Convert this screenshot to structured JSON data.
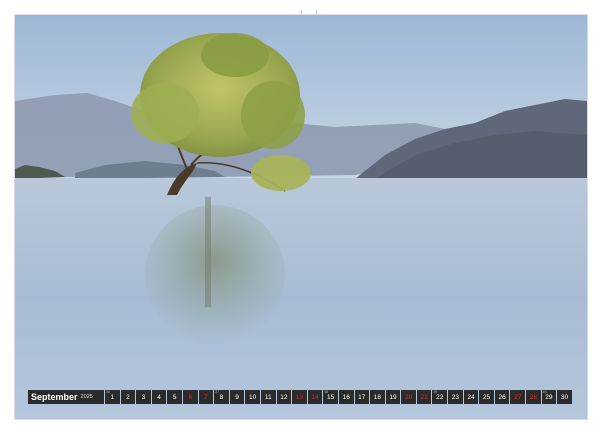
{
  "calendar": {
    "month": "September",
    "year": "2025",
    "days": [
      {
        "num": "1",
        "weekend": false,
        "week": "36"
      },
      {
        "num": "2",
        "weekend": false,
        "week": ""
      },
      {
        "num": "3",
        "weekend": false,
        "week": ""
      },
      {
        "num": "4",
        "weekend": false,
        "week": ""
      },
      {
        "num": "5",
        "weekend": false,
        "week": ""
      },
      {
        "num": "6",
        "weekend": true,
        "week": ""
      },
      {
        "num": "7",
        "weekend": true,
        "week": ""
      },
      {
        "num": "8",
        "weekend": false,
        "week": "37"
      },
      {
        "num": "9",
        "weekend": false,
        "week": ""
      },
      {
        "num": "10",
        "weekend": false,
        "week": ""
      },
      {
        "num": "11",
        "weekend": false,
        "week": ""
      },
      {
        "num": "12",
        "weekend": false,
        "week": ""
      },
      {
        "num": "13",
        "weekend": true,
        "week": ""
      },
      {
        "num": "14",
        "weekend": true,
        "week": ""
      },
      {
        "num": "15",
        "weekend": false,
        "week": "38"
      },
      {
        "num": "16",
        "weekend": false,
        "week": ""
      },
      {
        "num": "17",
        "weekend": false,
        "week": ""
      },
      {
        "num": "18",
        "weekend": false,
        "week": ""
      },
      {
        "num": "19",
        "weekend": false,
        "week": ""
      },
      {
        "num": "20",
        "weekend": true,
        "week": ""
      },
      {
        "num": "21",
        "weekend": true,
        "week": ""
      },
      {
        "num": "22",
        "weekend": false,
        "week": "39"
      },
      {
        "num": "23",
        "weekend": false,
        "week": ""
      },
      {
        "num": "24",
        "weekend": false,
        "week": ""
      },
      {
        "num": "25",
        "weekend": false,
        "week": ""
      },
      {
        "num": "26",
        "weekend": false,
        "week": ""
      },
      {
        "num": "27",
        "weekend": true,
        "week": ""
      },
      {
        "num": "28",
        "weekend": true,
        "week": ""
      },
      {
        "num": "29",
        "weekend": false,
        "week": "40"
      },
      {
        "num": "30",
        "weekend": false,
        "week": ""
      }
    ]
  },
  "colors": {
    "sky_top": "#a9c1dc",
    "sky_bottom": "#c7d5e6",
    "water": "#b6c8de",
    "mountain_far": "#8e9bb0",
    "mountain_near": "#5d6775",
    "tree_foliage": "#9aa84a",
    "tree_trunk": "#4a3a2a",
    "weekend_red": "#e0282e"
  },
  "photo": {
    "subject": "lone-willow-tree-in-lake"
  }
}
